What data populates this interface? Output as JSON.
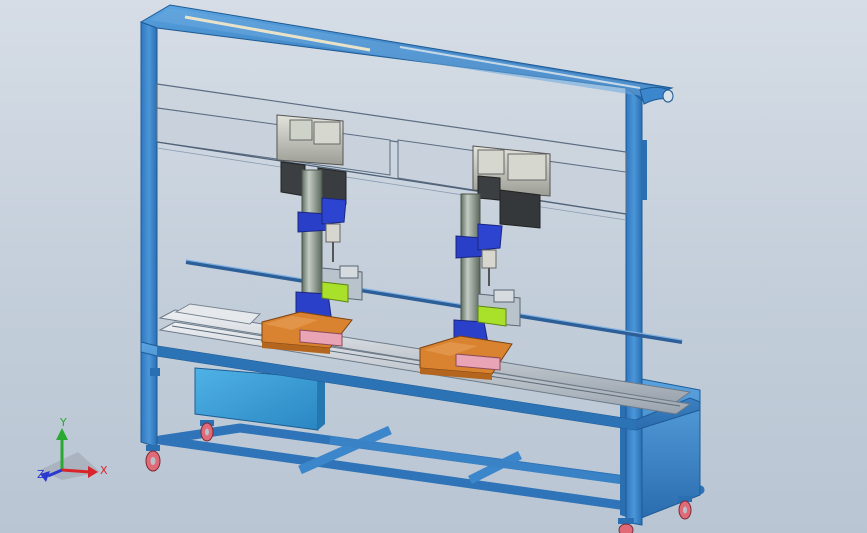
{
  "triad": {
    "x_label": "X",
    "y_label": "Y",
    "z_label": "Z",
    "x_color": "#d8242a",
    "y_color": "#2aa832",
    "z_color": "#2a3ad0"
  },
  "colors": {
    "frame": "#3d86cc",
    "frame_dark": "#1f5a97",
    "cabinet": "#3aa1dc",
    "drill_blue": "#2a3fc8",
    "plate_orange": "#d9822f",
    "jaw_green": "#a8e02a",
    "wheel_red": "#e06a78",
    "panel_glass": "#c9d2dc"
  }
}
